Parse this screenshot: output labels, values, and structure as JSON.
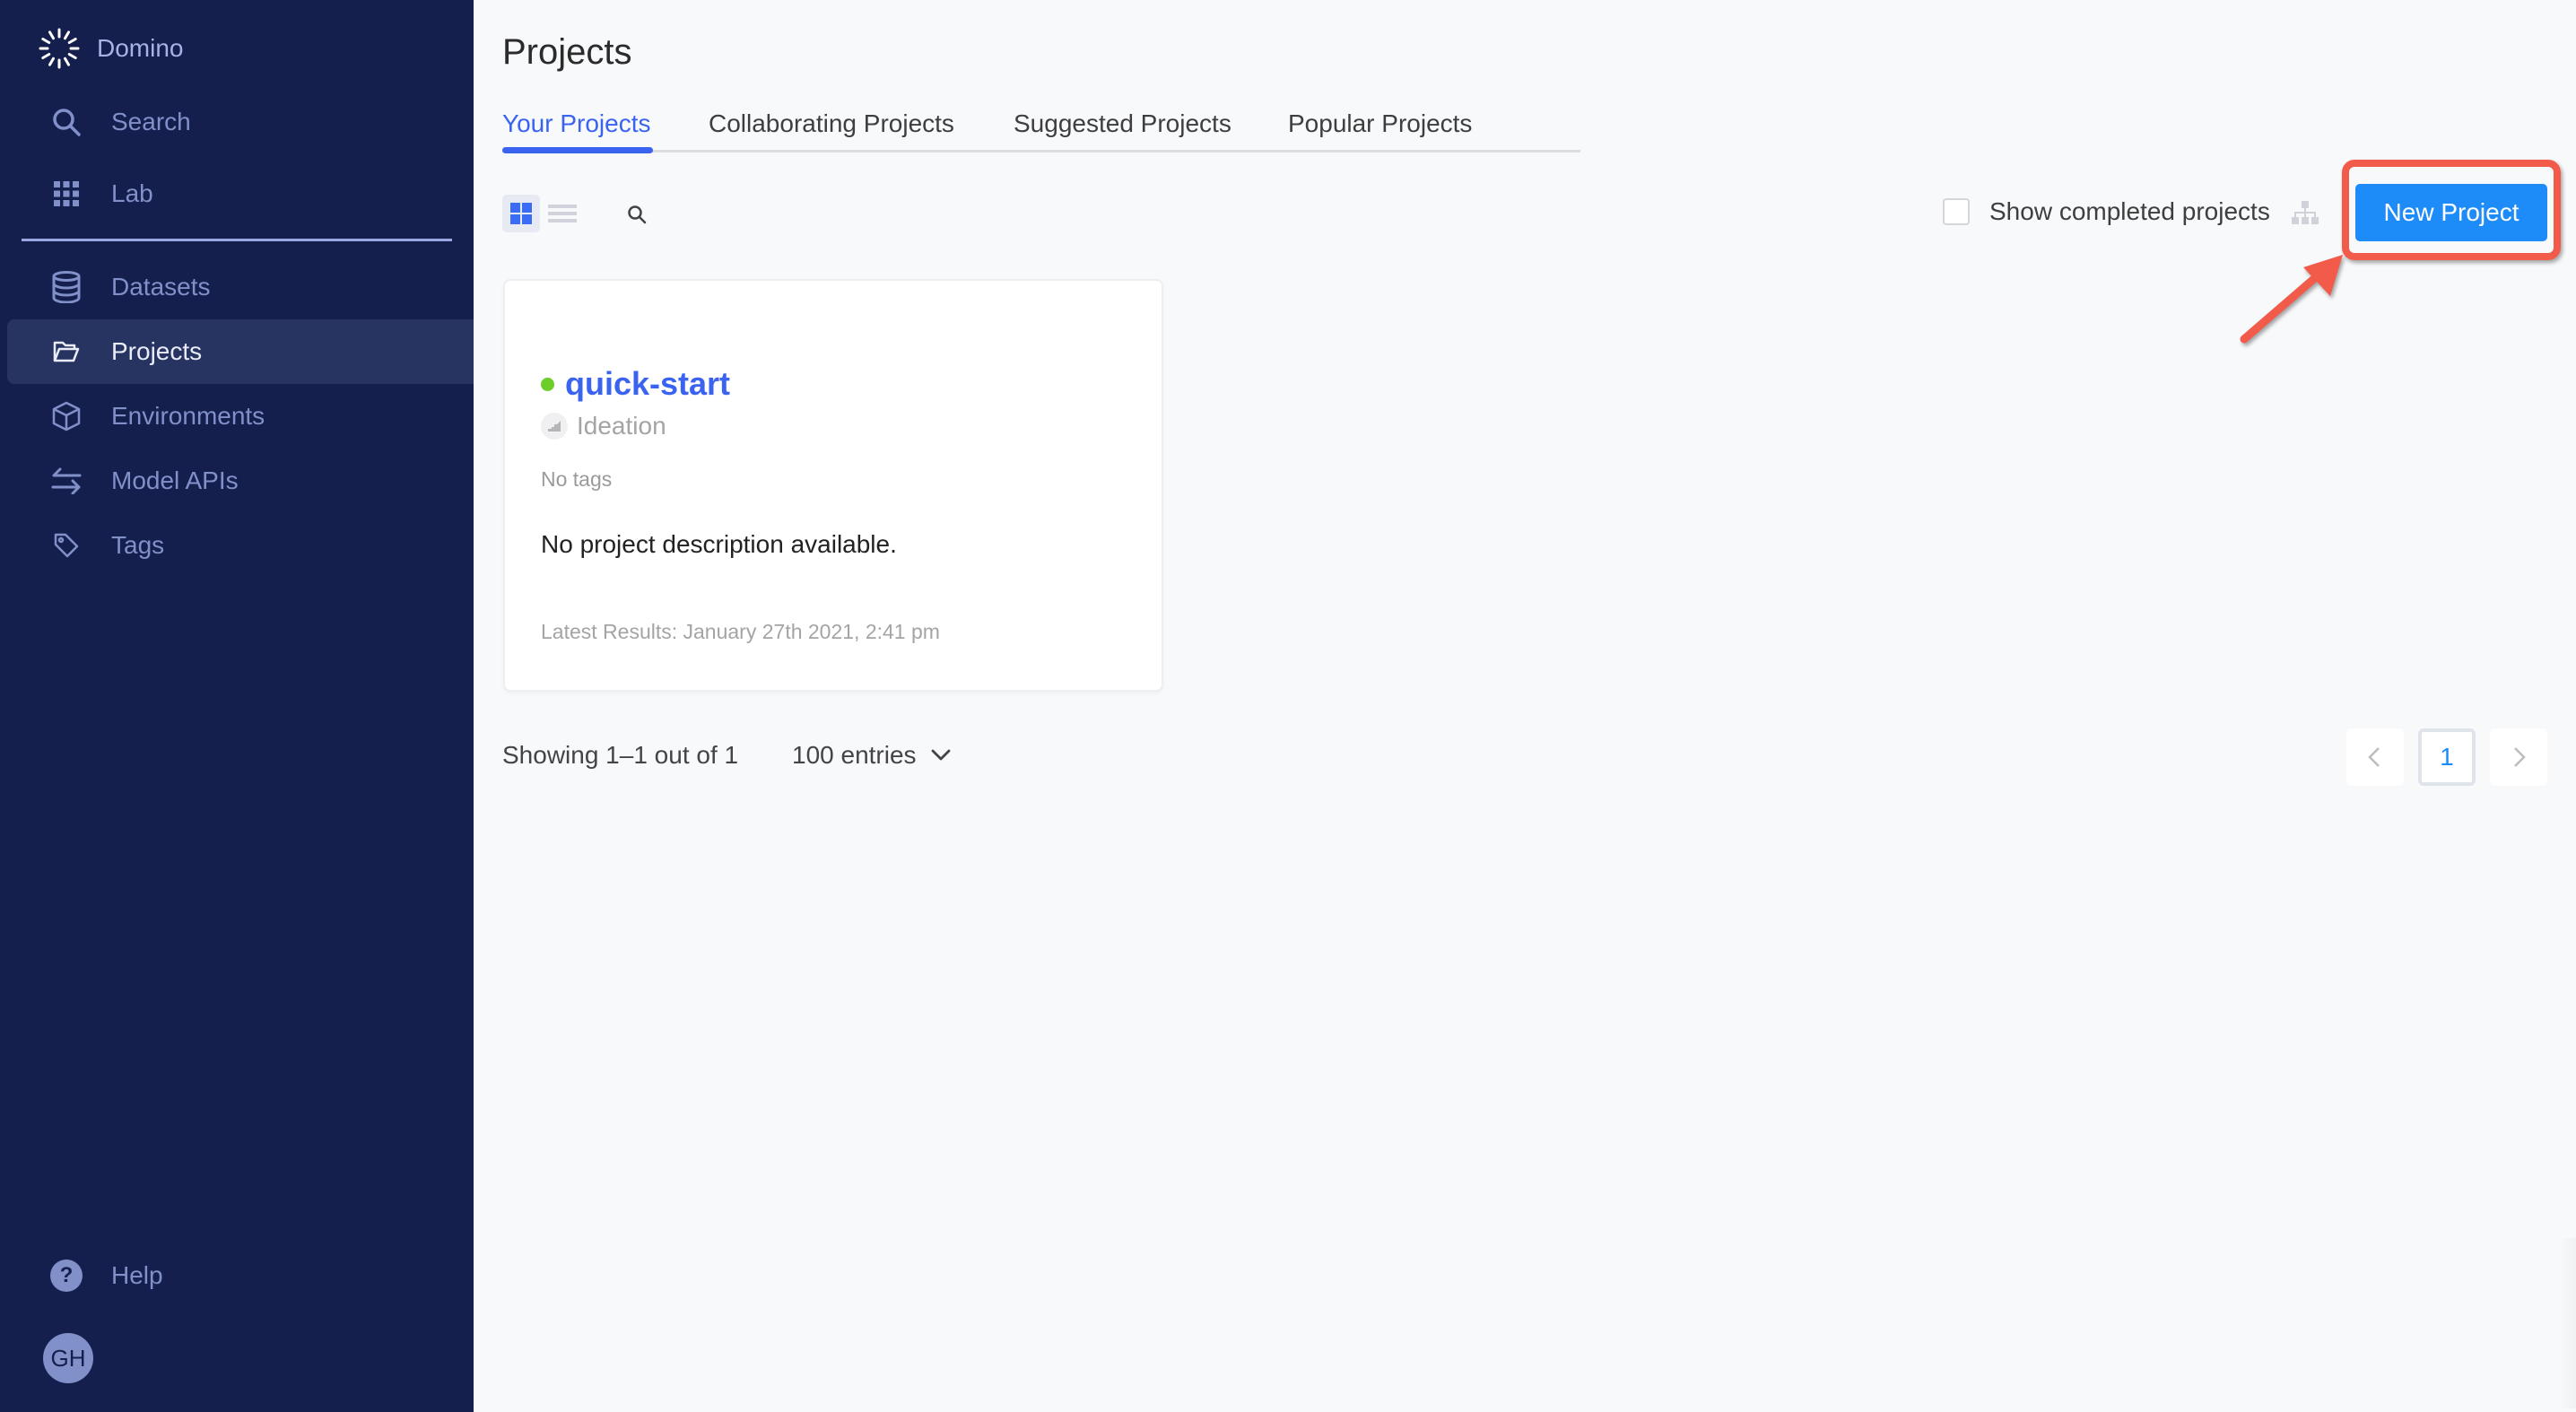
{
  "sidebar": {
    "brand": "Domino",
    "items": [
      {
        "label": "Search",
        "icon": "search-icon"
      },
      {
        "label": "Lab",
        "icon": "grid-icon"
      },
      {
        "label": "Datasets",
        "icon": "database-icon"
      },
      {
        "label": "Projects",
        "icon": "folder-open-icon",
        "active": true
      },
      {
        "label": "Environments",
        "icon": "cube-icon"
      },
      {
        "label": "Model APIs",
        "icon": "arrows-exchange-icon"
      },
      {
        "label": "Tags",
        "icon": "tag-icon"
      }
    ],
    "help_label": "Help",
    "help_glyph": "?",
    "avatar_initials": "GH"
  },
  "header": {
    "title": "Projects"
  },
  "tabs": [
    {
      "label": "Your Projects",
      "active": true
    },
    {
      "label": "Collaborating Projects"
    },
    {
      "label": "Suggested Projects"
    },
    {
      "label": "Popular Projects"
    }
  ],
  "toolbar": {
    "view_mode": "grid",
    "show_completed_label": "Show completed projects",
    "show_completed_checked": false,
    "new_project_label": "New Project"
  },
  "projects": [
    {
      "name": "quick-start",
      "status_color": "#6dce2a",
      "stage": "Ideation",
      "tags_text": "No tags",
      "description": "No project description available.",
      "latest_results": "Latest Results: January 27th 2021, 2:41 pm"
    }
  ],
  "pagination": {
    "showing_text": "Showing 1–1 out of 1",
    "entries_label": "100 entries",
    "current_page": "1"
  },
  "colors": {
    "sidebar_bg": "#141f4d",
    "accent": "#3a63f0",
    "primary_button": "#1d8cf8",
    "annotation": "#f25a4a"
  }
}
